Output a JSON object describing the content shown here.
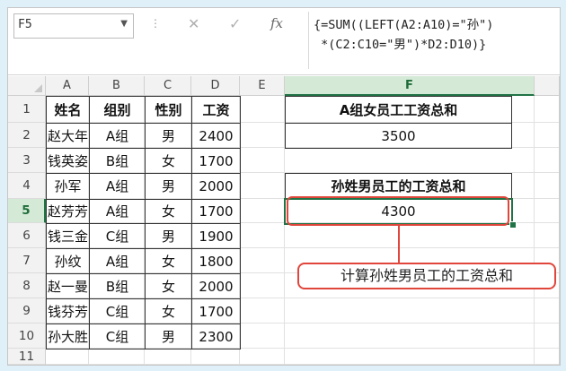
{
  "name_box": {
    "value": "F5",
    "dropdown_icon": "chevron-down-icon"
  },
  "formula_bar": {
    "more_icon": "vertical-dots-icon",
    "cancel_icon": "close-icon",
    "confirm_icon": "checkmark-icon",
    "fx_label": "fx",
    "formula_line1": "{=SUM((LEFT(A2:A10)=\"孙\")",
    "formula_line2": " *(C2:C10=\"男\")*D2:D10)}"
  },
  "columns": [
    "A",
    "B",
    "C",
    "D",
    "E",
    "F"
  ],
  "rows": [
    "1",
    "2",
    "3",
    "4",
    "5",
    "6",
    "7",
    "8",
    "9",
    "10",
    "11"
  ],
  "table": {
    "headers": [
      "姓名",
      "组别",
      "性别",
      "工资"
    ],
    "records": [
      [
        "赵大年",
        "A组",
        "男",
        "2400"
      ],
      [
        "钱英姿",
        "B组",
        "女",
        "1700"
      ],
      [
        "孙军",
        "A组",
        "男",
        "2000"
      ],
      [
        "赵芳芳",
        "A组",
        "女",
        "1700"
      ],
      [
        "钱三金",
        "C组",
        "男",
        "1900"
      ],
      [
        "孙纹",
        "A组",
        "女",
        "1800"
      ],
      [
        "赵一曼",
        "B组",
        "女",
        "2000"
      ],
      [
        "钱芬芳",
        "C组",
        "女",
        "1700"
      ],
      [
        "孙大胜",
        "C组",
        "男",
        "2300"
      ]
    ]
  },
  "summary": {
    "f1": "A组女员工工资总和",
    "f2": "3500",
    "f4": "孙姓男员工的工资总和",
    "f5": "4300"
  },
  "callout": {
    "text": "计算孙姓男员工的工资总和"
  },
  "colors": {
    "accent_green": "#217346",
    "highlight_red": "#e0463b",
    "frame_bg": "#dff0f8"
  }
}
